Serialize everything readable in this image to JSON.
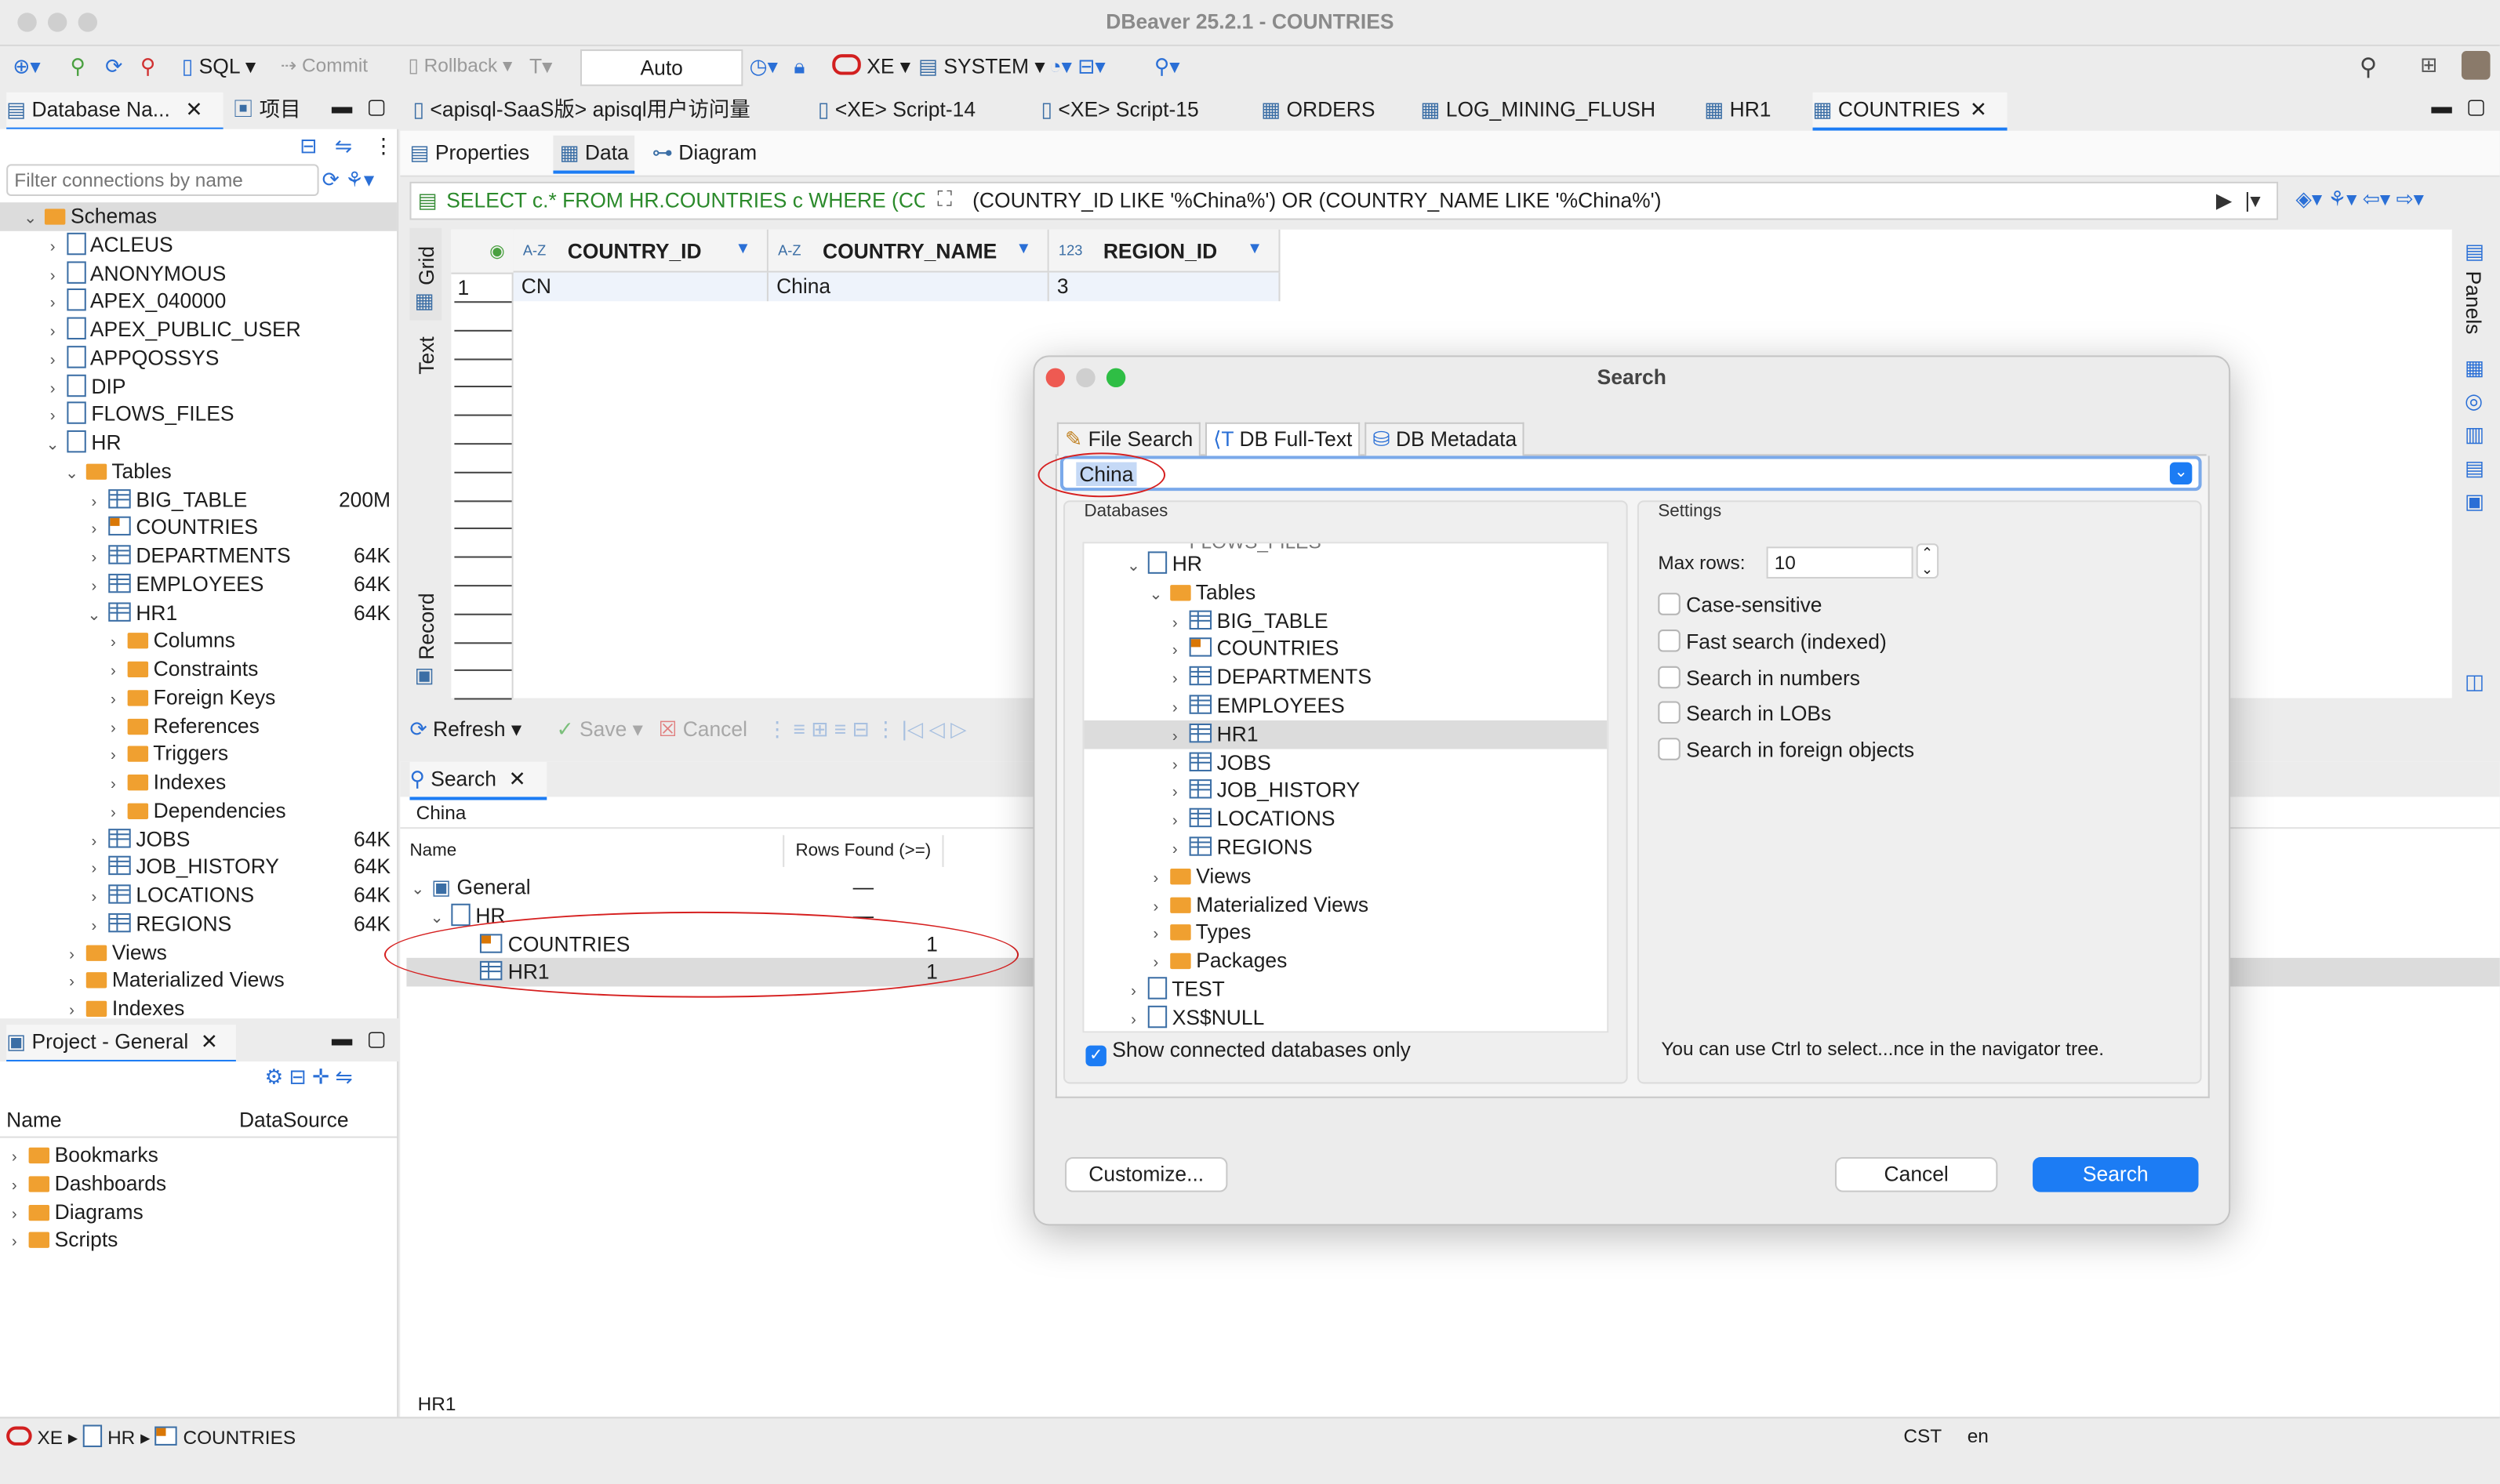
{
  "window": {
    "title": "DBeaver 25.2.1 - COUNTRIES"
  },
  "toolbar": {
    "sql": "SQL",
    "commit": "Commit",
    "rollback": "Rollback",
    "tx_mode": "Auto",
    "connection": "XE",
    "schema": "SYSTEM"
  },
  "editor_tabs": [
    {
      "label": "<apisql-SaaS版> apisql用户访问量"
    },
    {
      "label": "<XE> Script-14"
    },
    {
      "label": "<XE> Script-15"
    },
    {
      "label": "ORDERS"
    },
    {
      "label": "LOG_MINING_FLUSH"
    },
    {
      "label": "HR1"
    },
    {
      "label": "COUNTRIES"
    }
  ],
  "navigator": {
    "tab_label": "Database Na...",
    "project_tab": "项目",
    "filter_placeholder": "Filter connections by name",
    "schemas_label": "Schemas",
    "schemas": [
      "ACLEUS",
      "ANONYMOUS",
      "APEX_040000",
      "APEX_PUBLIC_USER",
      "APPQOSSYS",
      "DIP",
      "FLOWS_FILES",
      "HR"
    ],
    "tables_label": "Tables",
    "tables": [
      {
        "name": "BIG_TABLE",
        "size": "200M"
      },
      {
        "name": "COUNTRIES",
        "size": ""
      },
      {
        "name": "DEPARTMENTS",
        "size": "64K"
      },
      {
        "name": "EMPLOYEES",
        "size": "64K"
      },
      {
        "name": "HR1",
        "size": "64K"
      }
    ],
    "hr1_children": [
      "Columns",
      "Constraints",
      "Foreign Keys",
      "References",
      "Triggers",
      "Indexes",
      "Dependencies"
    ],
    "more_tables": [
      {
        "name": "JOBS",
        "size": "64K"
      },
      {
        "name": "JOB_HISTORY",
        "size": "64K"
      },
      {
        "name": "LOCATIONS",
        "size": "64K"
      },
      {
        "name": "REGIONS",
        "size": "64K"
      }
    ],
    "bottom_items": [
      "Views",
      "Materialized Views",
      "Indexes"
    ]
  },
  "project": {
    "tab_label": "Project - General",
    "col_name": "Name",
    "col_datasource": "DataSource",
    "items": [
      "Bookmarks",
      "Dashboards",
      "Diagrams",
      "Scripts"
    ]
  },
  "editor": {
    "subtabs": [
      "Properties",
      "Data",
      "Diagram"
    ],
    "sql_left": "SELECT c.* FROM HR.COUNTRIES c WHERE (COU",
    "sql_right": "(COUNTRY_ID LIKE '%China%') OR (COUNTRY_NAME LIKE '%China%')",
    "side_tabs": [
      "Grid",
      "Text",
      "Record"
    ],
    "panels_label": "Panels",
    "columns": [
      {
        "type": "A-Z",
        "name": "COUNTRY_ID"
      },
      {
        "type": "A-Z",
        "name": "COUNTRY_NAME"
      },
      {
        "type": "123",
        "name": "REGION_ID"
      }
    ],
    "rows": [
      {
        "num": "1",
        "cells": [
          "CN",
          "China",
          "3"
        ]
      }
    ],
    "refresh": "Refresh",
    "save": "Save",
    "cancel": "Cancel"
  },
  "search_panel": {
    "tab_label": "Search",
    "query": "China",
    "col_name": "Name",
    "col_rows": "Rows Found (>=)",
    "general": "General",
    "general_count": "—",
    "hr": "HR",
    "hr_count": "—",
    "results": [
      {
        "name": "COUNTRIES",
        "count": "1"
      },
      {
        "name": "HR1",
        "count": "1"
      }
    ]
  },
  "status_bar": {
    "left_label": "HR1",
    "crumb": [
      "XE",
      "HR",
      "COUNTRIES"
    ],
    "tz": "CST",
    "lang": "en"
  },
  "dialog": {
    "title": "Search",
    "tabs": [
      "File Search",
      "DB Full-Text",
      "DB Metadata"
    ],
    "query": "China",
    "databases_label": "Databases",
    "settings_label": "Settings",
    "tree": [
      {
        "label": "HR",
        "level": 0,
        "icon": "db",
        "chev": "v"
      },
      {
        "label": "Tables",
        "level": 1,
        "icon": "folder",
        "chev": "v"
      },
      {
        "label": "BIG_TABLE",
        "level": 2,
        "icon": "table",
        "chev": ">"
      },
      {
        "label": "COUNTRIES",
        "level": 2,
        "icon": "table-c",
        "chev": ">"
      },
      {
        "label": "DEPARTMENTS",
        "level": 2,
        "icon": "table",
        "chev": ">"
      },
      {
        "label": "EMPLOYEES",
        "level": 2,
        "icon": "table",
        "chev": ">"
      },
      {
        "label": "HR1",
        "level": 2,
        "icon": "table",
        "chev": ">"
      },
      {
        "label": "JOBS",
        "level": 2,
        "icon": "table",
        "chev": ">"
      },
      {
        "label": "JOB_HISTORY",
        "level": 2,
        "icon": "table",
        "chev": ">"
      },
      {
        "label": "LOCATIONS",
        "level": 2,
        "icon": "table",
        "chev": ">"
      },
      {
        "label": "REGIONS",
        "level": 2,
        "icon": "table",
        "chev": ">"
      },
      {
        "label": "Views",
        "level": 1,
        "icon": "folder",
        "chev": ">"
      },
      {
        "label": "Materialized Views",
        "level": 1,
        "icon": "folder",
        "chev": ">"
      },
      {
        "label": "Types",
        "level": 1,
        "icon": "folder",
        "chev": ">"
      },
      {
        "label": "Packages",
        "level": 1,
        "icon": "folder",
        "chev": ">"
      },
      {
        "label": "TEST",
        "level": 0,
        "icon": "db",
        "chev": ">"
      },
      {
        "label": "XS$NULL",
        "level": 0,
        "icon": "db",
        "chev": ">"
      }
    ],
    "show_connected": "Show connected databases only",
    "max_rows_label": "Max rows:",
    "max_rows": "10",
    "options": [
      "Case-sensitive",
      "Fast search (indexed)",
      "Search in numbers",
      "Search in LOBs",
      "Search in foreign objects"
    ],
    "hint": "You can use Ctrl to select...nce in the navigator tree.",
    "customize": "Customize...",
    "cancel": "Cancel",
    "search": "Search"
  },
  "colors": {
    "accent": "#1c7cf4",
    "annotation": "#d62020",
    "selection": "#dcdcdc"
  }
}
